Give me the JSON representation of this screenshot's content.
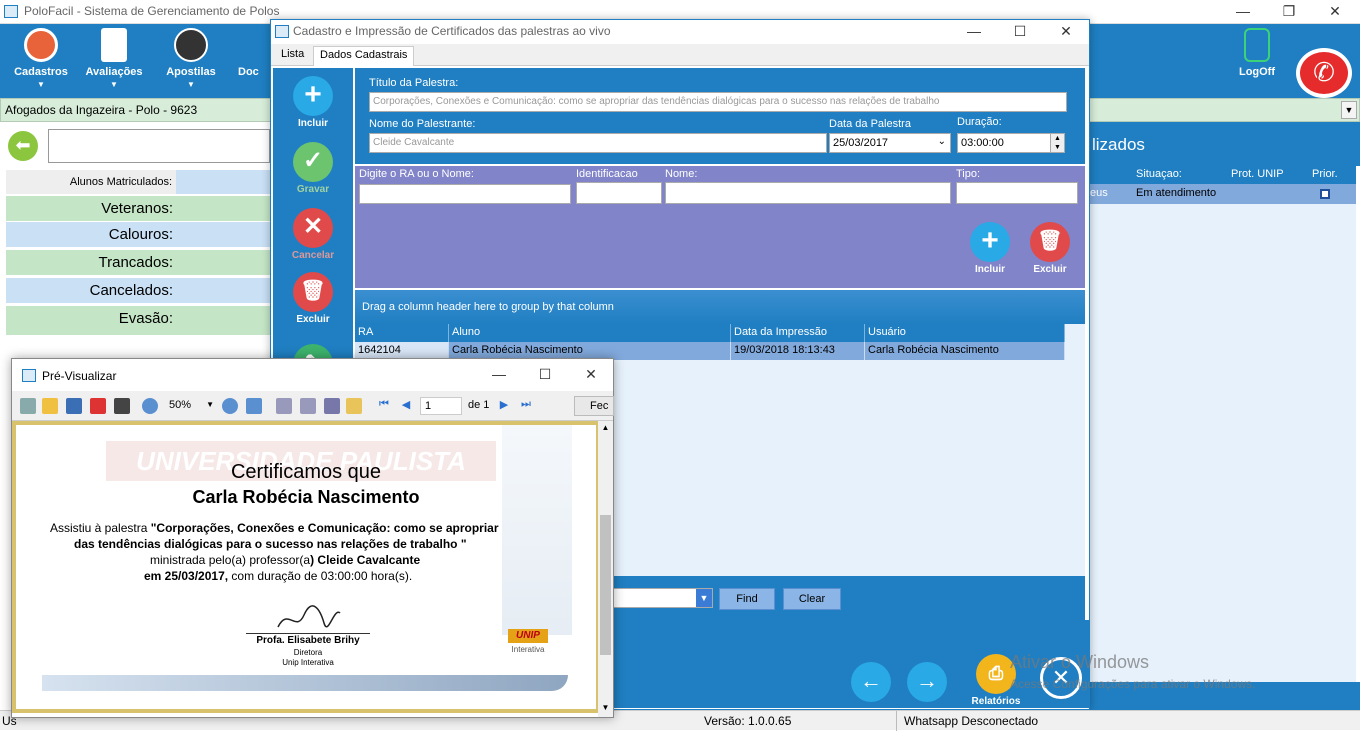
{
  "main_window": {
    "title": "PoloFacil - Sistema de Gerenciamento de Polos"
  },
  "toolbar": {
    "items": [
      {
        "label": "Cadastros"
      },
      {
        "label": "Avaliações"
      },
      {
        "label": "Apostilas"
      },
      {
        "label": "Doc"
      }
    ],
    "logoff": "LogOff"
  },
  "polo": {
    "name": "Afogados da Ingazeira - Polo - 9623"
  },
  "stats": {
    "header": "Alunos Matriculados:",
    "rows": [
      "Veteranos:",
      "Calouros:",
      "Trancados:",
      "Cancelados:",
      "Evasão:"
    ]
  },
  "right_panel": {
    "title": "lizados",
    "columns": [
      "Situaçao:",
      "Prot. UNIP",
      "Prior."
    ],
    "row": {
      "partial": "eus",
      "situacao": "Em atendimento"
    }
  },
  "cadastro": {
    "title": "Cadastro e Impressão de Certificados das palestras ao vivo",
    "tabs": [
      "Lista",
      "Dados Cadastrais"
    ],
    "side_buttons": [
      "Incluir",
      "Gravar",
      "Cancelar",
      "Excluir"
    ],
    "titulo_label": "Título da Palestra:",
    "titulo_value": "Corporações, Conexões e Comunicação: como se apropriar das tendências dialógicas para o sucesso nas relações de trabalho",
    "palestrante_label": "Nome do Palestrante:",
    "palestrante_value": "Cleide Cavalcante",
    "data_label": "Data da Palestra",
    "data_value": "25/03/2017",
    "duracao_label": "Duração:",
    "duracao_value": "03:00:00",
    "ra_label": "Digite o RA ou o Nome:",
    "ident_label": "Identificacao",
    "nome_label": "Nome:",
    "tipo_label": "Tipo:",
    "incluir": "Incluir",
    "excluir": "Excluir",
    "group_hint": "Drag a column header here to group by that column",
    "grid_columns": [
      "RA",
      "Aluno",
      "Data da Impressão",
      "Usuário"
    ],
    "grid_rows": [
      {
        "ra": "1642104",
        "aluno": "Carla Robécia Nascimento",
        "data": "19/03/2018 18:13:43",
        "usuario": "Carla Robécia Nascimento"
      }
    ],
    "find": "Find",
    "clear": "Clear",
    "relatorios": "Relatórios"
  },
  "preview": {
    "title": "Pré-Visualizar",
    "zoom": "50%",
    "page": "1",
    "page_of": "de 1",
    "close_partial": "Fec",
    "watermark": "UNIVERSIDADE PAULISTA",
    "cert_title": "Certificamos que",
    "cert_name": "Carla Robécia Nascimento",
    "cert_line1_prefix": "Assistiu à palestra ",
    "cert_line1_bold": "\"Corporações, Conexões e Comunicação: como se apropriar",
    "cert_line2": "das tendências dialógicas para o sucesso nas relações de trabalho    \"",
    "cert_line3_prefix": "ministrada pelo(a) professor(a",
    "cert_line3_bold": ") Cleide Cavalcante",
    "cert_line4_bold": "em 25/03/2017,",
    "cert_line4_rest": " com duração de  03:00:00 hora(s).",
    "signer": "Profa. Elisabete Brihy",
    "signer_role": "Diretora",
    "signer_org": "Unip Interativa",
    "logo_text": "UNIP",
    "logo_sub": "Interativa"
  },
  "statusbar": {
    "left": "Us",
    "version": "Versão: 1.0.0.65",
    "whatsapp": "Whatsapp Desconectado"
  },
  "activation": {
    "title": "Ativar o Windows",
    "subtitle": "Acesse Configurações para ativar o Windows."
  },
  "colors": {
    "accent": "#1f7fc2",
    "purple": "#8184c8",
    "green": "#d7ecd9"
  }
}
